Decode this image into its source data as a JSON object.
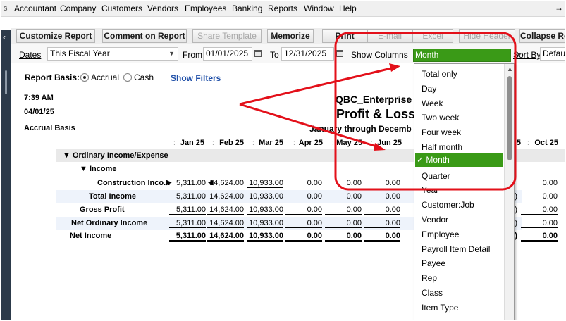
{
  "menu": {
    "items": [
      "Accountant",
      "Company",
      "Customers",
      "Vendors",
      "Employees",
      "Banking",
      "Reports",
      "Window",
      "Help"
    ],
    "pin_glyph": "→"
  },
  "toolbar": {
    "customize": "Customize Report",
    "comment": "Comment on Report",
    "share": "Share Template",
    "memorize": "Memorize",
    "print": "Print",
    "email": "E-mail",
    "excel": "Excel",
    "hide_header": "Hide Header",
    "collapse": "Collapse Ro"
  },
  "filters": {
    "dates_label": "Dates",
    "dates_value": "This Fiscal Year",
    "from_label": "From",
    "from_value": "01/01/2025",
    "to_label": "To",
    "to_value": "12/31/2025",
    "show_columns_label": "Show Columns",
    "show_columns_value": "Month",
    "sort_by_label": "Sort By",
    "sort_by_value": "Defaul"
  },
  "basis": {
    "label": "Report Basis:",
    "accrual": "Accrual",
    "cash": "Cash",
    "show_filters": "Show Filters"
  },
  "report": {
    "time": "7:39 AM",
    "date": "04/01/25",
    "basis": "Accrual Basis",
    "company": "QBC_Enterprise",
    "title": "Profit & Loss",
    "period": "January through Decemb"
  },
  "columns": [
    "Jan 25",
    "Feb 25",
    "Mar 25",
    "Apr 25",
    "May 25",
    "Jun 25"
  ],
  "right_columns": [
    "5",
    "Oct 25"
  ],
  "rows": {
    "ordinary": "Ordinary Income/Expense",
    "income": "Income",
    "construction": "Construction Inco...",
    "total_income": "Total Income",
    "gross_profit": "Gross Profit",
    "net_ordinary": "Net Ordinary Income",
    "net_income": "Net Income",
    "values": [
      "5,311.00",
      "14,624.00",
      "10,933.00",
      "0.00",
      "0.00",
      "0.00"
    ],
    "right_zero": "0.00",
    "right_partial": ")"
  },
  "dropdown": {
    "items": [
      "Total only",
      "Day",
      "Week",
      "Two week",
      "Four week",
      "Half month",
      "Month",
      "Quarter",
      "Year",
      "Customer:Job",
      "Vendor",
      "Employee",
      "Payroll Item Detail",
      "Payee",
      "Rep",
      "Class",
      "Item Type"
    ],
    "selected_index": 6,
    "check": "✓"
  },
  "colors": {
    "selected_green": "#3a9a17",
    "annotation_red": "#e3101a"
  }
}
